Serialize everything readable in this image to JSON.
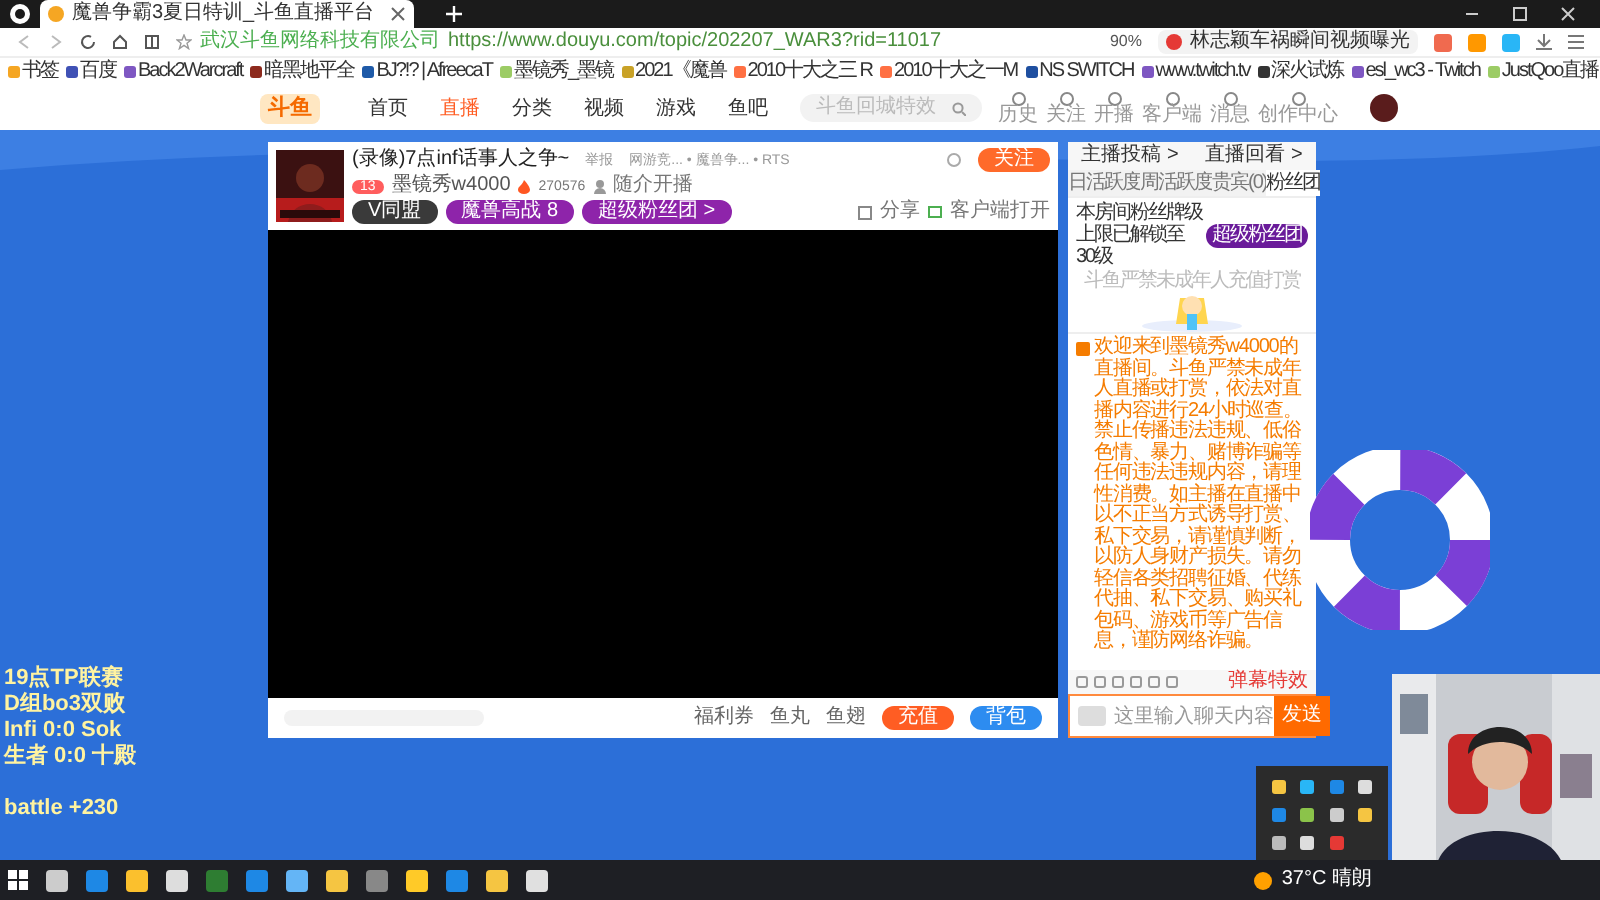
{
  "browser": {
    "tab_title": "魔兽争霸3夏日特训_斗鱼直播平台",
    "site_name": "武汉斗鱼网络科技有限公司",
    "url": "https://www.douyu.com/topic/202207_WAR3?rid=11017",
    "zoom": "90%",
    "hot_search": "林志颖车祸瞬间视频曝光"
  },
  "bookmarks": [
    "书签",
    "百度",
    "Back2Warcraft",
    "暗黑地平全",
    "BJ?!? | AfreecaT",
    "墨镜秀_墨镜",
    "2021《魔兽",
    "2010十大之三 R",
    "2010十大之一M",
    "NS SWITCH",
    "www.twitch.tv",
    "深火试炼",
    "esl_wc3 - Twitch",
    "JustQoo直播"
  ],
  "site_nav": {
    "logo": "斗鱼",
    "items": [
      {
        "label": "首页",
        "selected": false
      },
      {
        "label": "直播",
        "selected": true
      },
      {
        "label": "分类",
        "selected": false
      },
      {
        "label": "视频",
        "selected": false
      },
      {
        "label": "游戏",
        "selected": false
      },
      {
        "label": "鱼吧",
        "selected": false
      }
    ],
    "search_placeholder": "斗鱼回城特效",
    "tools": [
      "历史",
      "关注",
      "开播",
      "客户端",
      "消息",
      "创作中心"
    ]
  },
  "room": {
    "title": "(录像)7点inf话事人之争~",
    "report": "举报",
    "category": "网游竞... • 魔兽争... • RTS",
    "level": "13",
    "streamer": "墨镜秀w4000",
    "hot": "270576",
    "note": "随介开播",
    "badges": [
      "V同盟",
      "魔兽高战 8",
      "超级粉丝团 >"
    ],
    "follow": "关注",
    "share": "分享",
    "client": "客户端打开"
  },
  "player_bar": {
    "coupon": "福利券",
    "fishball": "鱼丸",
    "fishfin": "鱼翅",
    "recharge": "充值",
    "bag": "背包"
  },
  "chat": {
    "links": [
      "主播投稿 >",
      "直播回看 >"
    ],
    "tabs": [
      {
        "label": "日活跃度",
        "selected": false
      },
      {
        "label": "周活跃度",
        "selected": false
      },
      {
        "label": "贵宾(0)",
        "selected": false
      },
      {
        "label": "粉丝团",
        "selected": true
      }
    ],
    "fan_note": "本房间粉丝牌级上限已解锁至30级",
    "fan_button": "超级粉丝团",
    "minor_note": "斗鱼严禁未成年人充值打赏",
    "notice": "欢迎来到墨镜秀w4000的直播间。斗鱼严禁未成年人直播或打赏，依法对直播内容进行24小时巡查。禁止传播违法违规、低俗色情、暴力、赌博诈骗等任何违法违规内容，请理性消费。如主播在直播中以不正当方式诱导打赏、私下交易，请谨慎判断，以防人身财产损失。请勿轻信各类招聘征婚、代练代抽、私下交易、购买礼包码、游戏币等广告信息，谨防网络诈骗。",
    "barrage_toggle": "弹幕特效",
    "placeholder": "这里输入聊天内容",
    "send": "发送"
  },
  "overlay": [
    "19点TP联赛",
    "D组bo3双败",
    "Infi 0:0 Sok",
    "生者 0:0 十殿",
    "battle +230"
  ],
  "taskbar": {
    "weather": "37°C 晴朗"
  }
}
